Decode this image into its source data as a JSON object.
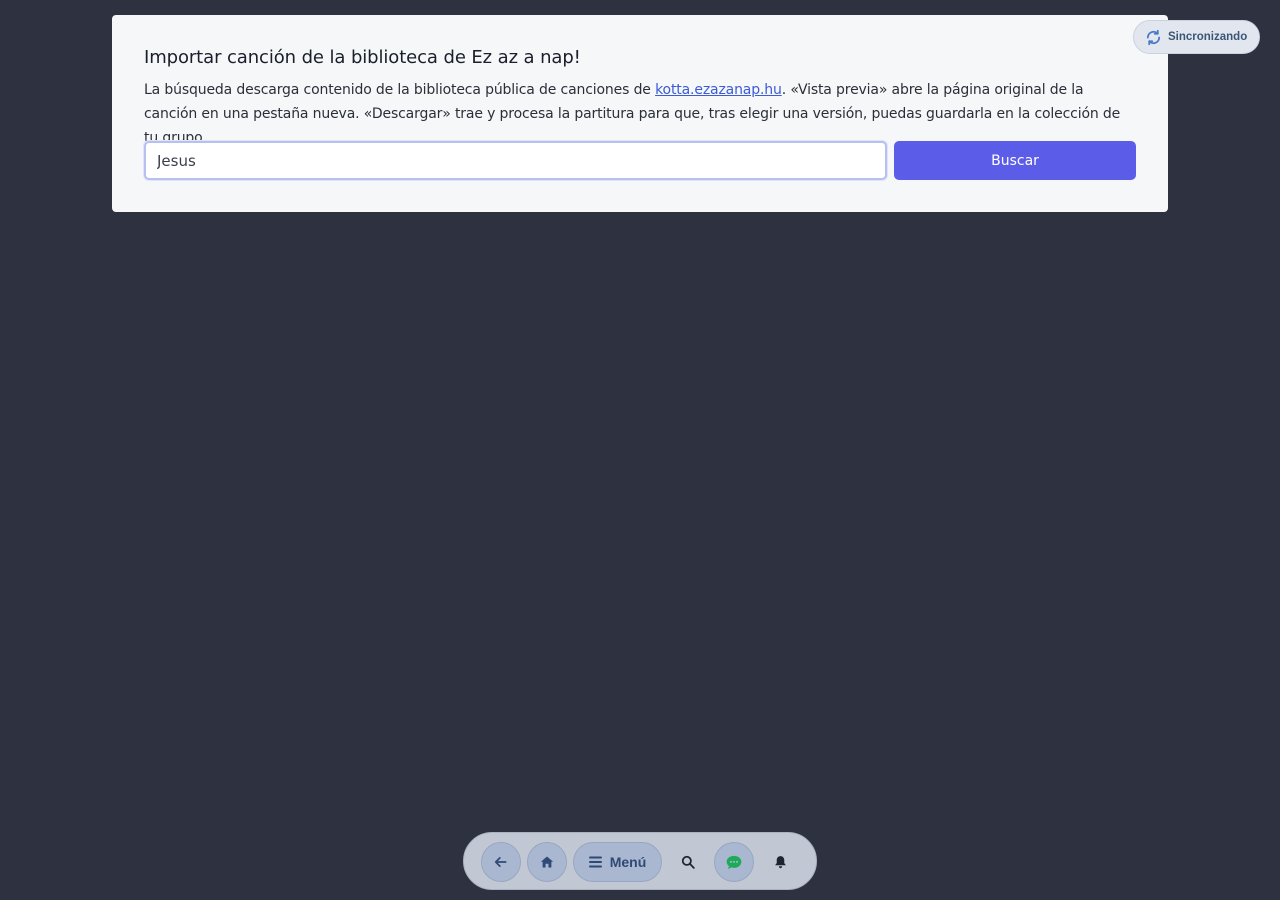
{
  "import_card": {
    "title": "Importar canción de la biblioteca de Ez az a nap!",
    "description_before_link": "La búsqueda descarga contenido de la biblioteca pública de canciones de ",
    "link_text": "kotta.ezazanap.hu",
    "description_after_link": ". «Vista previa» abre la página original de la canción en una pestaña nueva. «Descargar» trae y procesa la partitura para que, tras elegir una versión, puedas guardarla en la colección de tu grupo.",
    "search_value": "Jesus",
    "search_button_label": "Buscar"
  },
  "sync_status": {
    "label": "Sincronizando",
    "icon": "refresh-icon"
  },
  "bottom_nav": {
    "back_icon": "arrow-left-icon",
    "home_icon": "home-icon",
    "menu_icon": "hamburger-icon",
    "menu_label": "Menú",
    "search_icon": "search-icon",
    "chat_icon": "chat-icon",
    "notifications_icon": "bell-icon"
  },
  "colors": {
    "background": "#2e3240",
    "card": "#f5f7f9",
    "accent": "#5b5ce8",
    "link": "#3c5bd6",
    "chat_green": "#1faa59",
    "nav_icon": "#2f4a74"
  }
}
